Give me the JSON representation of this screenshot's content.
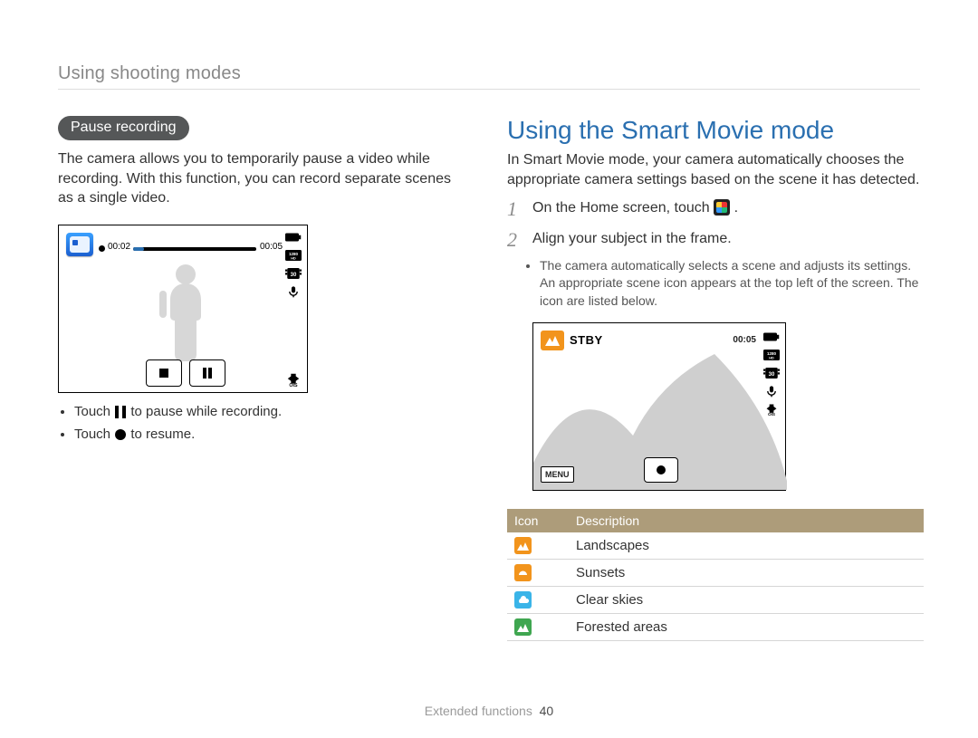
{
  "breadcrumb": "Using shooting modes",
  "left": {
    "pill": "Pause recording",
    "para": "The camera allows you to temporarily pause a video while recording. With this function, you can record separate scenes as a single video.",
    "screen": {
      "elapsed": "00:02",
      "remaining": "00:05",
      "resolution": "1280 HD",
      "fps": "30"
    },
    "bullets": {
      "pause_pre": "Touch ",
      "pause_post": " to pause while recording.",
      "resume_pre": "Touch ",
      "resume_post": " to resume."
    }
  },
  "right": {
    "heading": "Using the Smart Movie mode",
    "intro": "In Smart Movie mode, your camera automatically chooses the appropriate camera settings based on the scene it has detected.",
    "steps": {
      "s1_num": "1",
      "s1_pre": "On the Home screen, touch ",
      "s1_post": ".",
      "s2_num": "2",
      "s2_text": "Align your subject in the frame.",
      "s2_sub": "The camera automatically selects a scene and adjusts its settings. An appropriate scene icon appears at the top left of the screen. The icon are listed below."
    },
    "screen": {
      "stby": "STBY",
      "remaining": "00:05",
      "resolution": "1280 HD",
      "fps": "30",
      "menu": "MENU"
    },
    "table": {
      "headers": {
        "icon": "Icon",
        "desc": "Description"
      },
      "rows": [
        {
          "label": "Landscapes",
          "color": "c-orange",
          "shape": "mountain"
        },
        {
          "label": "Sunsets",
          "color": "c-orange",
          "shape": "sunset"
        },
        {
          "label": "Clear skies",
          "color": "c-blue",
          "shape": "cloud"
        },
        {
          "label": "Forested areas",
          "color": "c-green",
          "shape": "mountain"
        }
      ]
    }
  },
  "footer": {
    "section": "Extended functions",
    "page": "40"
  }
}
